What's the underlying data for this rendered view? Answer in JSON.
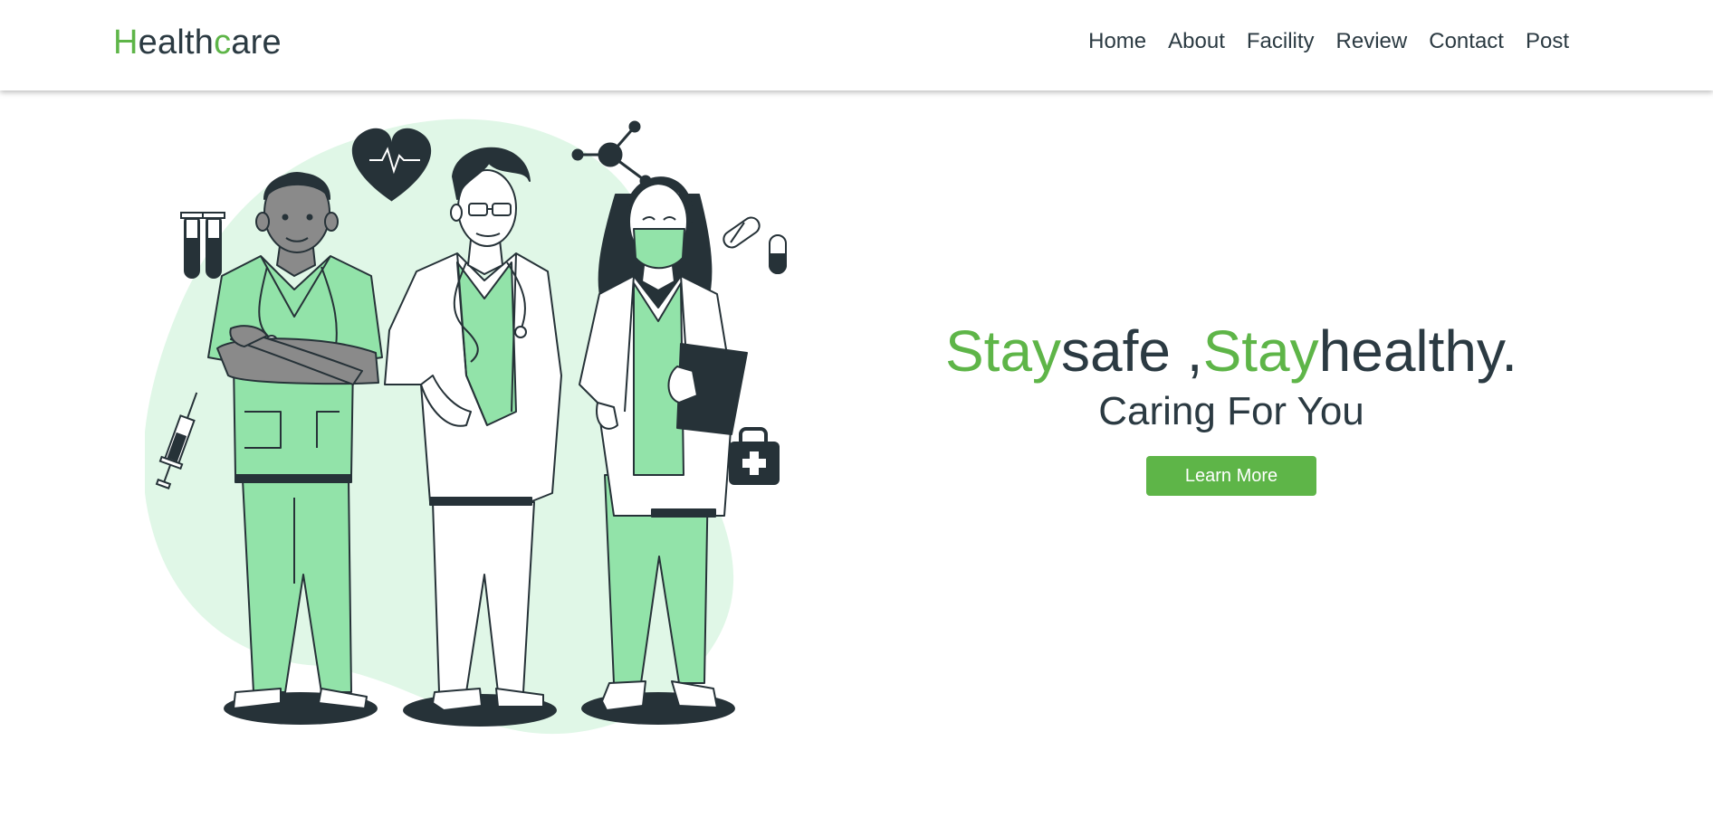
{
  "brand": {
    "first_letter": "H",
    "part_a": "ealth",
    "mid_letter": "c",
    "part_b": "are"
  },
  "nav": {
    "items": [
      {
        "label": "Home"
      },
      {
        "label": "About"
      },
      {
        "label": "Facility"
      },
      {
        "label": "Review"
      },
      {
        "label": "Contact"
      },
      {
        "label": "Post"
      }
    ]
  },
  "hero": {
    "headline": {
      "stay_1": "Stay",
      "rest_1": "safe ,",
      "stay_2": "Stay",
      "rest_2": "healthy."
    },
    "subheadline": "Caring For You",
    "cta_label": "Learn More"
  },
  "colors": {
    "accent": "#5eb548",
    "text": "#2b3a42",
    "blob": "#e0f7e7",
    "scrubs": "#92e3a9"
  },
  "illustration": {
    "icons": [
      "test-tubes-icon",
      "heart-pulse-icon",
      "molecule-icon",
      "pill-icon",
      "syringe-icon",
      "first-aid-kit-icon"
    ]
  }
}
